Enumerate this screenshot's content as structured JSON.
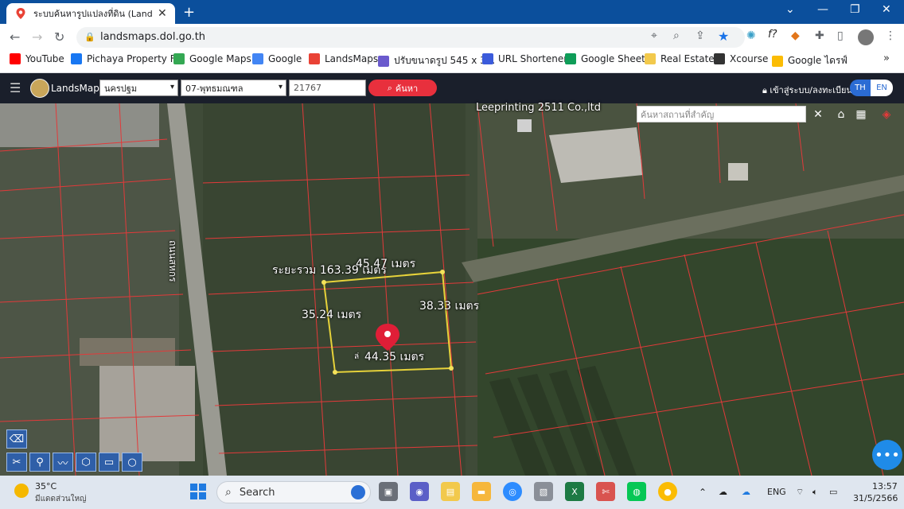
{
  "browser": {
    "tab_title": "ระบบค้นหารูปแปลงที่ดิน (LandsMaps",
    "tab_close": "✕",
    "new_tab": "+",
    "url": "landsmaps.dol.go.th",
    "window_buttons": {
      "chevron": "⌄",
      "minimize": "—",
      "restore": "❐",
      "close": "✕"
    }
  },
  "bookmarks": [
    {
      "label": "YouTube",
      "icon": "youtube-icon",
      "color": "#ff0000"
    },
    {
      "label": "Pichaya Property FB",
      "icon": "facebook-icon",
      "color": "#1877f2"
    },
    {
      "label": "Google Maps",
      "icon": "maps-icon",
      "color": "#34a853"
    },
    {
      "label": "Google",
      "icon": "google-icon",
      "color": "#4285f4"
    },
    {
      "label": "LandsMaps",
      "icon": "landsmaps-icon",
      "color": "#e94235"
    },
    {
      "label": "ปรับขนาดรูป 545 x 3...",
      "icon": "resize-icon",
      "color": "#6a5acd"
    },
    {
      "label": "URL Shortener",
      "icon": "url-icon",
      "color": "#3b5bdb"
    },
    {
      "label": "Google Sheet",
      "icon": "sheets-icon",
      "color": "#0f9d58"
    },
    {
      "label": "Real Estate",
      "icon": "folder-icon",
      "color": "#f2c94c"
    },
    {
      "label": "Xcourse",
      "icon": "xcourse-icon",
      "color": "#333333"
    },
    {
      "label": "Google ไดรฟ์",
      "icon": "drive-icon",
      "color": "#fbbc04"
    }
  ],
  "app": {
    "name": "LandsMaps",
    "province": "นครปฐม",
    "district": "07-พุทธมณฑล",
    "parcel_number": "21767",
    "search_button": "ค้นหา",
    "login": "เข้าสู่ระบบ/ลงทะเบียน",
    "lang_th": "TH",
    "lang_en": "EN",
    "place_search_placeholder": "ค้นหาสถานที่สำคัญ",
    "place_search_clear": "✕"
  },
  "map": {
    "poi_label": "Leeprinting 2511 Co.,ltd",
    "road_label": "ถนนสหกร",
    "total_perimeter": "ระยะรวม 163.39 เมตร",
    "side_top": "45.47 เมตร",
    "side_left": "35.24 เมตร",
    "side_right": "38.33 เมตร",
    "side_bottom": "44.35 เมตร",
    "marker_prefix": "ล่"
  },
  "tools": [
    "eraser-icon",
    "measure-icon",
    "pin-icon",
    "line-icon",
    "polygon-icon",
    "rectangle-icon",
    "circle-icon"
  ],
  "taskbar": {
    "temperature": "35°C",
    "weather_text": "มีแดดส่วนใหญ่",
    "search_label": "Search",
    "language": "ENG",
    "time": "13:57",
    "date": "31/5/2566"
  }
}
